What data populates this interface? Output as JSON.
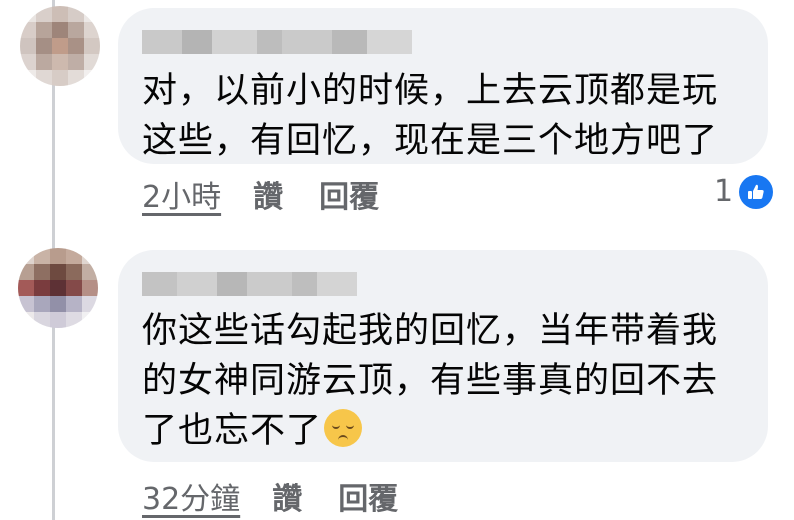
{
  "comments": [
    {
      "author_redacted": true,
      "text_lines": [
        "对，以前小的时候，上去云顶都是玩",
        "这些，有回忆，现在是三个地方吧了"
      ],
      "time": "2小時",
      "like_label": "讚",
      "reply_label": "回覆",
      "reaction_count": "1",
      "reaction_icon": "like-thumbs-up-icon"
    },
    {
      "author_redacted": true,
      "text_lines": [
        "你这些话勾起我的回忆，当年带着我",
        "的女神同游云顶，有些事真的回不去",
        "了也忘不了"
      ],
      "emoji": "pensive-face-icon",
      "time": "32分鐘",
      "like_label": "讚",
      "reply_label": "回覆"
    }
  ],
  "colors": {
    "bubble_bg": "#f0f2f5",
    "text": "#050505",
    "meta_text": "#65676b",
    "like_blue": "#1877f2",
    "thread_line": "#ced0d4"
  }
}
